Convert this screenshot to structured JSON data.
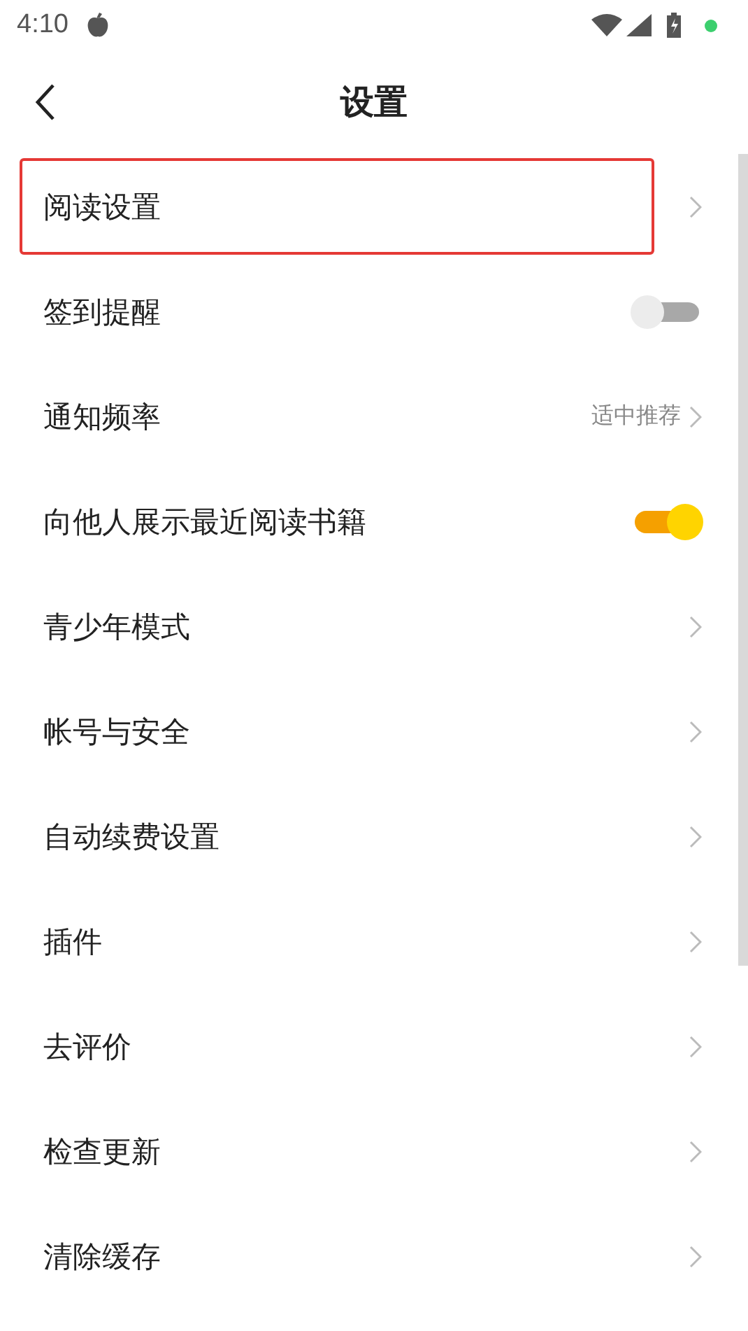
{
  "status_bar": {
    "time": "4:10"
  },
  "header": {
    "title": "设置"
  },
  "rows": [
    {
      "kind": "link",
      "label": "阅读设置",
      "highlighted": true
    },
    {
      "kind": "toggle",
      "label": "签到提醒",
      "on": false,
      "highlighted": false
    },
    {
      "kind": "link",
      "label": "通知频率",
      "value": "适中推荐",
      "highlighted": false
    },
    {
      "kind": "toggle",
      "label": "向他人展示最近阅读书籍",
      "on": true,
      "highlighted": false
    },
    {
      "kind": "link",
      "label": "青少年模式",
      "highlighted": false
    },
    {
      "kind": "link",
      "label": "帐号与安全",
      "highlighted": false
    },
    {
      "kind": "link",
      "label": "自动续费设置",
      "highlighted": false
    },
    {
      "kind": "link",
      "label": "插件",
      "highlighted": false
    },
    {
      "kind": "link",
      "label": "去评价",
      "highlighted": false
    },
    {
      "kind": "link",
      "label": "检查更新",
      "highlighted": false
    },
    {
      "kind": "link",
      "label": "清除缓存",
      "highlighted": false
    }
  ]
}
